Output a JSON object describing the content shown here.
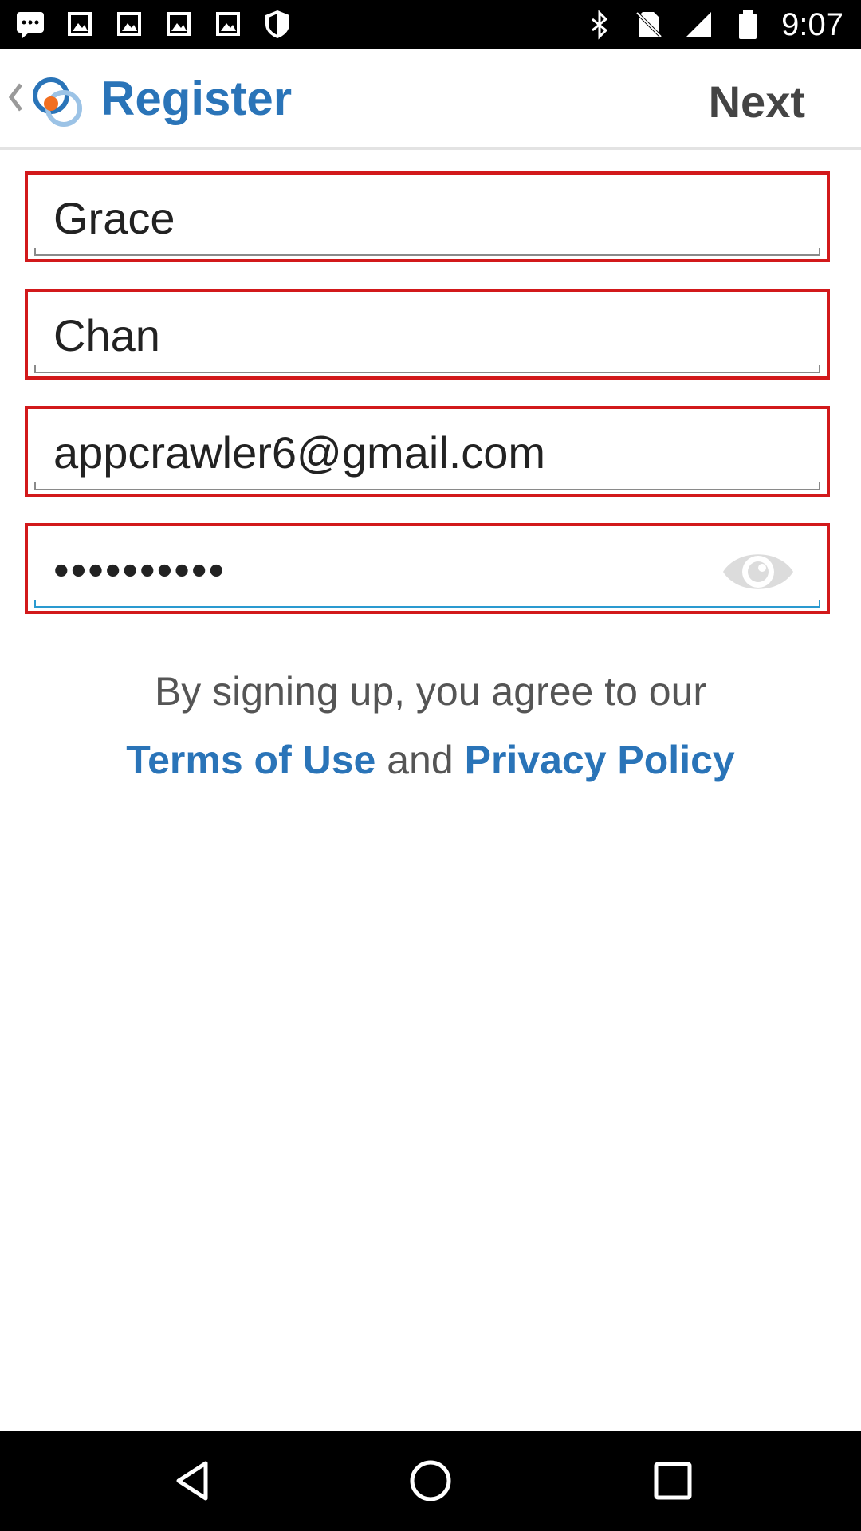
{
  "status_bar": {
    "time": "9:07",
    "left_icons": [
      "chat-icon",
      "image-icon",
      "image-icon",
      "image-icon",
      "image-icon",
      "shield-icon"
    ],
    "right_icons": [
      "bluetooth-icon",
      "no-sim-icon",
      "signal-icon",
      "battery-icon"
    ]
  },
  "header": {
    "title": "Register",
    "next_label": "Next",
    "brand_blue": "#2a74b8",
    "brand_orange": "#f26f21"
  },
  "form": {
    "first_name": "Grace",
    "last_name": "Chan",
    "email": "appcrawler6@gmail.com",
    "password_masked": "••••••••••",
    "field_border_color": "#d2191b"
  },
  "agreement": {
    "prefix": "By signing up, you agree to our",
    "terms_label": "Terms of Use",
    "conjunction": "and",
    "privacy_label": "Privacy Policy"
  },
  "nav": {
    "buttons": [
      "back-icon",
      "home-icon",
      "recents-icon"
    ]
  }
}
